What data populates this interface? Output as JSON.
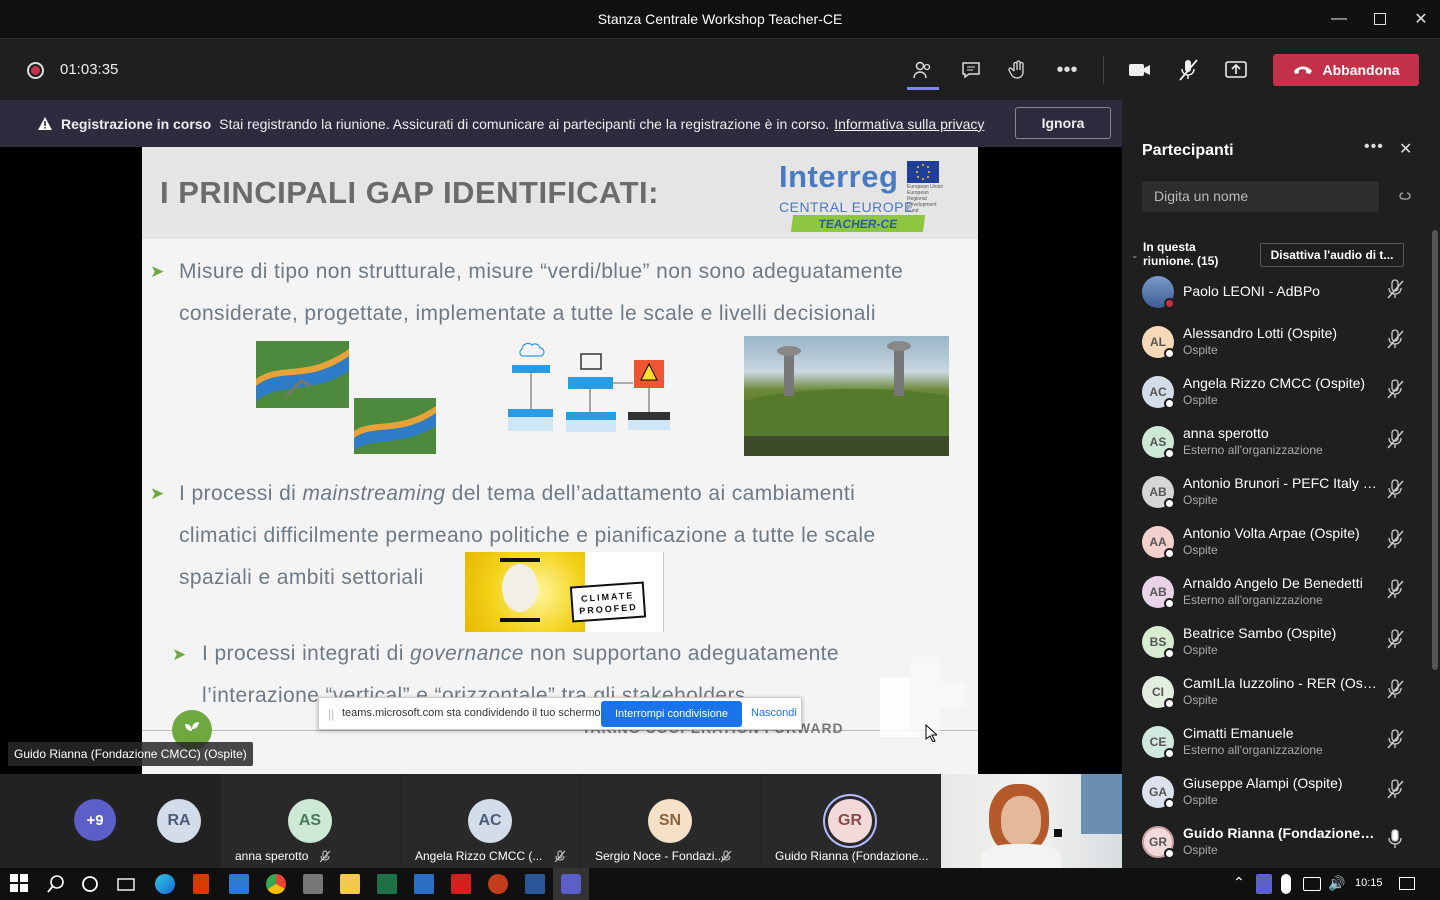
{
  "window": {
    "title": "Stanza Centrale Workshop Teacher-CE"
  },
  "toolbar": {
    "timer": "01:03:35",
    "leave_label": "Abbandona"
  },
  "banner": {
    "bold": "Registrazione in corso",
    "text": "Stai registrando la riunione. Assicurati di comunicare ai partecipanti che la registrazione è in corso.",
    "link": "Informativa sulla privacy",
    "button": "Ignora"
  },
  "slide": {
    "title": "I PRINCIPALI GAP IDENTIFICATI:",
    "logo": {
      "line1": "Interreg",
      "line2": "CENTRAL EUROPE",
      "line3": "TEACHER-CE",
      "eu": "European Union European Regional Development Fund"
    },
    "bullet1_line1": "Misure di tipo non strutturale, misure “verdi/blue” non sono adeguatamente",
    "bullet1_line2": "considerate, progettate, implementate a tutte le scale e livelli decisionali",
    "bullet2_pre": "I processi di ",
    "bullet2_em": "mainstreaming",
    "bullet2_post": " del tema dell’adattamento ai cambiamenti",
    "bullet2_line2": "climatici difficilmente permeano politiche e pianificazione a tutte le scale",
    "bullet2_line3": "spaziali e ambiti settoriali",
    "stamp": "CLIMATE PROOFED",
    "sub_pre": "I processi integrati di ",
    "sub_em": "governance",
    "sub_post": " non supportano adeguatamente",
    "sub_line2": "l’interazione “vertical” e “orizzontale” tra gli stakeholders",
    "footer": "TAKING COOPERATION FORWARD"
  },
  "share_bar": {
    "text": "teams.microsoft.com sta condividendo il tuo schermo.",
    "stop": "Interrompi condivisione",
    "hide": "Nascondi"
  },
  "presenter_label": "Guido Rianna (Fondazione CMCC) (Ospite)",
  "panel": {
    "title": "Partecipanti",
    "search_placeholder": "Digita un nome",
    "section": "In questa riunione. (15)",
    "mute_all": "Disattiva l'audio di t...",
    "people": [
      {
        "initials": "",
        "name": "Paolo LEONI - AdBPo",
        "sub": "",
        "color": "#cfd8e6"
      },
      {
        "initials": "AL",
        "name": "Alessandro Lotti (Ospite)",
        "sub": "Ospite",
        "color": "#f5d9b8"
      },
      {
        "initials": "AC",
        "name": "Angela Rizzo CMCC (Ospite)",
        "sub": "Ospite",
        "color": "#d3dde9"
      },
      {
        "initials": "AS",
        "name": "anna sperotto",
        "sub": "Esterno all'organizzazione",
        "color": "#cde9d6"
      },
      {
        "initials": "AB",
        "name": "Antonio Brunori - PEFC Italy (...",
        "sub": "Ospite",
        "color": "#d6d6d6"
      },
      {
        "initials": "AA",
        "name": "Antonio Volta Arpae (Ospite)",
        "sub": "Ospite",
        "color": "#f2d0cc"
      },
      {
        "initials": "AB",
        "name": "Arnaldo Angelo De Benedetti",
        "sub": "Esterno all'organizzazione",
        "color": "#e8d3e8"
      },
      {
        "initials": "BS",
        "name": "Beatrice Sambo (Ospite)",
        "sub": "Ospite",
        "color": "#d7ecd0"
      },
      {
        "initials": "CI",
        "name": "CamILla Iuzzolino - RER (Ospi...",
        "sub": "Ospite",
        "color": "#e3eee0"
      },
      {
        "initials": "CE",
        "name": "Cimatti Emanuele",
        "sub": "Esterno all'organizzazione",
        "color": "#cfe9de"
      },
      {
        "initials": "GA",
        "name": "Giuseppe Alampi (Ospite)",
        "sub": "Ospite",
        "color": "#dbe2ee"
      },
      {
        "initials": "GR",
        "name": "Guido Rianna (Fondazione C...",
        "sub": "Ospite",
        "color": "#f3dada"
      }
    ]
  },
  "strip": {
    "more": "+9",
    "ra": "RA",
    "tiles": [
      {
        "initials": "AS",
        "label": "anna sperotto",
        "color": "#cde9d6",
        "fg": "#4a7a5a"
      },
      {
        "initials": "AC",
        "label": "Angela Rizzo CMCC (...",
        "color": "#d3dde9",
        "fg": "#4a5e7a"
      },
      {
        "initials": "SN",
        "label": "Sergio Noce - Fondazi...",
        "color": "#f5e1c8",
        "fg": "#8a6434"
      },
      {
        "initials": "GR",
        "label": "Guido Rianna (Fondazione...",
        "color": "#f3dada",
        "fg": "#8a4a4a"
      }
    ]
  },
  "taskbar": {
    "time": "10:15"
  }
}
